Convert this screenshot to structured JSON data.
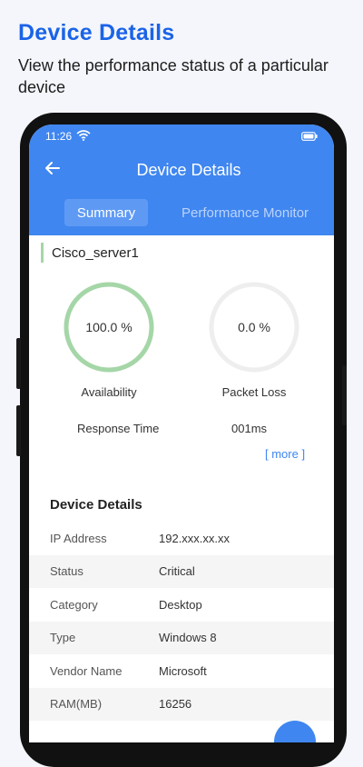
{
  "promo": {
    "title": "Device Details",
    "subtitle": "View the performance status of a particular device"
  },
  "status_bar": {
    "time": "11:26",
    "icons": [
      "wifi-icon",
      "battery-icon"
    ]
  },
  "app_bar": {
    "back_icon": "back-arrow-icon",
    "title": "Device Details"
  },
  "tabs": [
    {
      "label": "Summary",
      "selected": true
    },
    {
      "label": "Performance Monitor",
      "selected": false
    }
  ],
  "device": {
    "name": "Cisco_server1"
  },
  "metrics": {
    "availability": {
      "value": "100.0 %",
      "label": "Availability",
      "fraction": 1.0,
      "color": "#a5d6a7"
    },
    "packet_loss": {
      "value": "0.0 %",
      "label": "Packet Loss",
      "fraction": 0.0,
      "color": "#eeeeee"
    },
    "response_time": {
      "label": "Response Time",
      "value": "001ms"
    },
    "more_link": "[ more ]"
  },
  "details": {
    "title": "Device Details",
    "rows": [
      {
        "key": "IP Address",
        "value": "192.xxx.xx.xx"
      },
      {
        "key": "Status",
        "value": "Critical"
      },
      {
        "key": "Category",
        "value": "Desktop"
      },
      {
        "key": "Type",
        "value": "Windows 8"
      },
      {
        "key": "Vendor Name",
        "value": "Microsoft"
      },
      {
        "key": "RAM(MB)",
        "value": "16256"
      }
    ]
  },
  "colors": {
    "brand_blue": "#1a63e8",
    "app_bar": "#3f86f0",
    "availability_ring": "#a5d6a7"
  }
}
